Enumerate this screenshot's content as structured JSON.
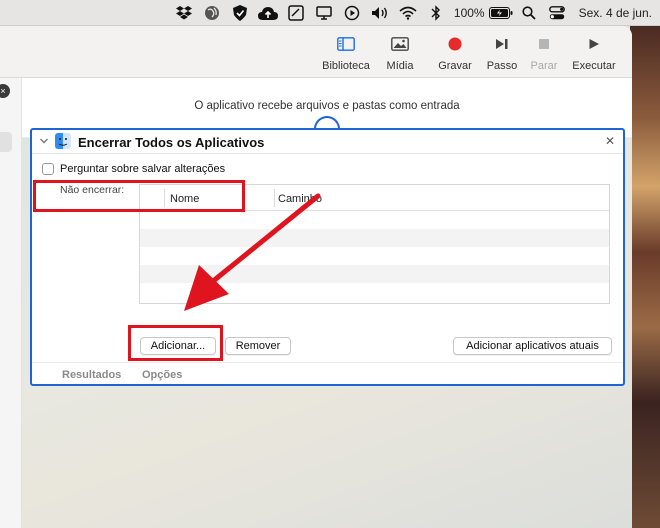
{
  "menubar": {
    "battery_percent": "100%",
    "date": "Sex. 4 de jun.",
    "icons": [
      "dropbox-icon",
      "globe-icon",
      "shield-check-icon",
      "cloud-upload-icon",
      "notes-icon",
      "display-icon",
      "play-circle-icon",
      "volume-icon",
      "wifi-icon",
      "bluetooth-icon",
      "battery-icon",
      "search-icon",
      "control-center-icon"
    ]
  },
  "toolbar": {
    "library": "Biblioteca",
    "media": "Mídia",
    "record": "Gravar",
    "step": "Passo",
    "stop": "Parar",
    "run": "Executar"
  },
  "workflow": {
    "input_note": "O aplicativo recebe arquivos e pastas como entrada"
  },
  "action": {
    "title": "Encerrar Todos os Aplicativos",
    "ask_save_label": "Perguntar sobre salvar alterações",
    "ask_save_checked": false,
    "do_not_quit_label": "Não encerrar:",
    "columns": [
      "Nome",
      "Caminho"
    ],
    "rows": [],
    "add_button": "Adicionar...",
    "remove_button": "Remover",
    "add_current_button": "Adicionar aplicativos atuais",
    "tabs": [
      "Resultados",
      "Opções"
    ]
  },
  "colors": {
    "accent": "#1f64d4",
    "highlight": "#e0141e",
    "record": "#e52b2b"
  }
}
